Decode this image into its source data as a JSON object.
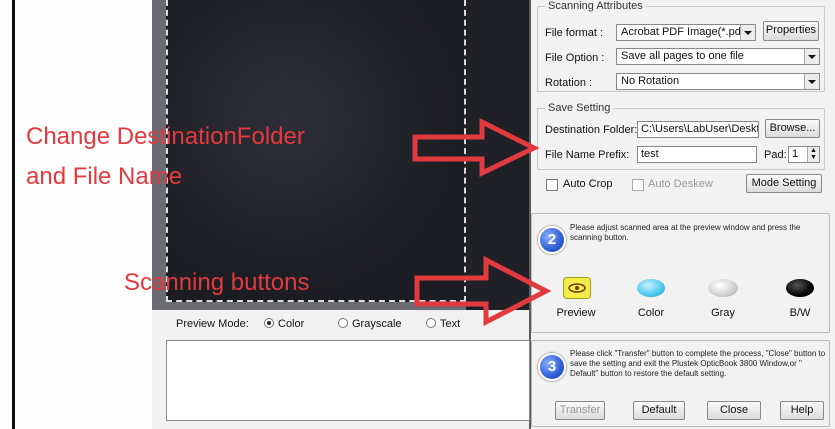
{
  "preview_mode": {
    "label": "Preview Mode:",
    "options": [
      "Color",
      "Grayscale",
      "Text"
    ],
    "selected": "Color"
  },
  "scanning_attributes": {
    "legend": "Scanning Attributes",
    "file_format_label": "File format :",
    "file_format_value": "Acrobat PDF Image(*.pdf)",
    "properties_button": "Properties",
    "file_option_label": "File Option :",
    "file_option_value": "Save all pages to one file",
    "rotation_label": "Rotation :",
    "rotation_value": "No Rotation"
  },
  "save_setting": {
    "legend": "Save Setting",
    "destination_label": "Destination Folder:",
    "destination_value": "C:\\Users\\LabUser\\Desktop",
    "browse_button": "Browse...",
    "prefix_label": "File Name Prefix:",
    "prefix_value": "test",
    "pad_label": "Pad:",
    "pad_value": "1"
  },
  "options": {
    "auto_crop": "Auto Crop",
    "auto_deskew": "Auto Deskew",
    "mode_setting_button": "Mode Setting"
  },
  "step2": {
    "number": "2",
    "instruction": "Please adjust scanned area at the preview window and press the scanning button.",
    "buttons": [
      "Preview",
      "Color",
      "Gray",
      "B/W"
    ]
  },
  "step3": {
    "number": "3",
    "instruction": "Please click \"Transfer\" button to complete the process, \"Close\" button to save the setting and exit the Plustek OpticBook 3800 Window,or \" Default\" button to restore the default setting.",
    "buttons": {
      "transfer": "Transfer",
      "default": "Default",
      "close": "Close",
      "help": "Help"
    }
  },
  "annotations": {
    "line1": "Change DestinationFolder",
    "line2": "and File Name",
    "scanning": "Scanning buttons"
  },
  "colors": {
    "annotation": "#e23a3e",
    "highlight": "#f5ec4a"
  }
}
